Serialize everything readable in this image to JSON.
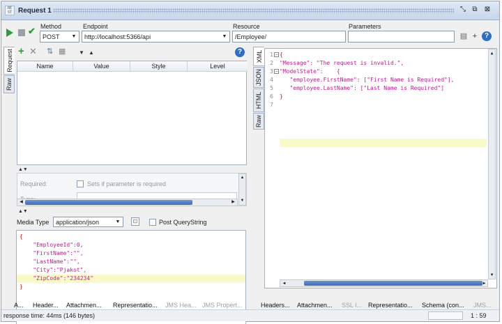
{
  "window": {
    "title": "Request 1"
  },
  "toolbar": {
    "method_label": "Method",
    "method_value": "POST",
    "endpoint_label": "Endpoint",
    "endpoint_value": "http://localhost:5366/api",
    "resource_label": "Resource",
    "resource_value": "/Employee/",
    "parameters_label": "Parameters",
    "parameters_value": ""
  },
  "request_tabs": [
    "Request",
    "Raw"
  ],
  "param_table": {
    "columns": [
      "Name",
      "Value",
      "Style",
      "Level"
    ]
  },
  "param_props": {
    "required_label": "Required:",
    "required_hint": "Sets if parameter is required",
    "type_label": "Type:"
  },
  "media": {
    "label": "Media Type",
    "value": "application/json",
    "post_querystring_label": "Post QueryString"
  },
  "request_body": [
    "{",
    "    \"EmployeeId\":0,",
    "    \"FirstName\":\"\",",
    "    \"LastName\":\"\",",
    "    \"City\":\"Pjakot\",",
    "    \"ZipCode\":\"234234\"",
    "}"
  ],
  "response_tabs": [
    "XML",
    "JSON",
    "HTML",
    "Raw"
  ],
  "response_body": [
    {
      "n": "1",
      "text": "{"
    },
    {
      "n": "2",
      "text": "\"Message\": \"The request is invalid.\","
    },
    {
      "n": "3",
      "text": "\"ModelState\":    {"
    },
    {
      "n": "4",
      "text": "   \"employee.FirstName\": [\"First Name is Required\"],"
    },
    {
      "n": "5",
      "text": "   \"employee.LastName\": [\"Last Name is Required\"]"
    },
    {
      "n": "6",
      "text": "}"
    },
    {
      "n": "7",
      "text": ""
    }
  ],
  "left_bottom_tabs": [
    "A...",
    "Header...",
    "Attachmen...",
    "Representatio...",
    "JMS Hea...",
    "JMS Propert..."
  ],
  "right_bottom_tabs": [
    "Headers...",
    "Attachmen...",
    "SSL I...",
    "Representatio...",
    "Schema (con...",
    "JMS..."
  ],
  "status": {
    "text": "response time: 44ms (146 bytes)",
    "position": "1 : 59"
  },
  "colors": {
    "json_string": "#c0198f",
    "highlight": "#fafac8",
    "play_green": "#2e9e3a",
    "scroll_blue": "#3d6fb8"
  }
}
